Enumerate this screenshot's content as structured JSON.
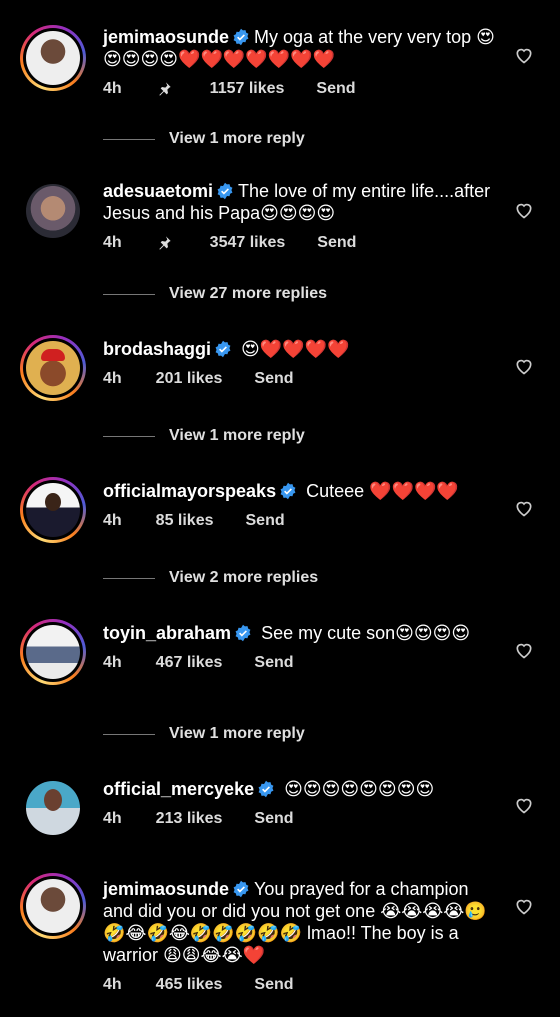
{
  "comments": [
    {
      "username": "jemimaosunde",
      "text": "My oga at the very very top 😍😍😍😍😍❤️❤️❤️❤️❤️❤️❤️",
      "time": "4h",
      "pinned": true,
      "likes": "1157 likes",
      "send": "Send",
      "more_replies": "View 1 more reply"
    },
    {
      "username": "adesuaetomi",
      "text": "The love of my entire life....after Jesus and his Papa😍😍😍😍",
      "time": "4h",
      "pinned": true,
      "likes": "3547 likes",
      "send": "Send",
      "more_replies": "View 27 more replies"
    },
    {
      "username": "brodashaggi",
      "text": "😍❤️❤️❤️❤️",
      "time": "4h",
      "pinned": false,
      "likes": "201 likes",
      "send": "Send",
      "more_replies": "View 1 more reply"
    },
    {
      "username": "officialmayorspeaks",
      "text": "Cuteee ❤️❤️❤️❤️",
      "time": "4h",
      "pinned": false,
      "likes": "85 likes",
      "send": "Send",
      "more_replies": "View 2 more replies"
    },
    {
      "username": "toyin_abraham",
      "text": "See my cute son😍😍😍😍",
      "time": "4h",
      "pinned": false,
      "likes": "467 likes",
      "send": "Send",
      "more_replies": "View 1 more reply"
    },
    {
      "username": "official_mercyeke",
      "text": "😍😍😍😍😍😍😍😍",
      "time": "4h",
      "pinned": false,
      "likes": "213 likes",
      "send": "Send"
    },
    {
      "username": "jemimaosunde",
      "text": "You prayed for a champion and did you or did you not get one 😭😭😭😭🥲🤣😂🤣😂🤣🤣🤣🤣🤣 lmao!! The boy is a warrior 😩😩😂😭❤️",
      "time": "4h",
      "pinned": false,
      "likes": "465 likes",
      "send": "Send"
    }
  ]
}
